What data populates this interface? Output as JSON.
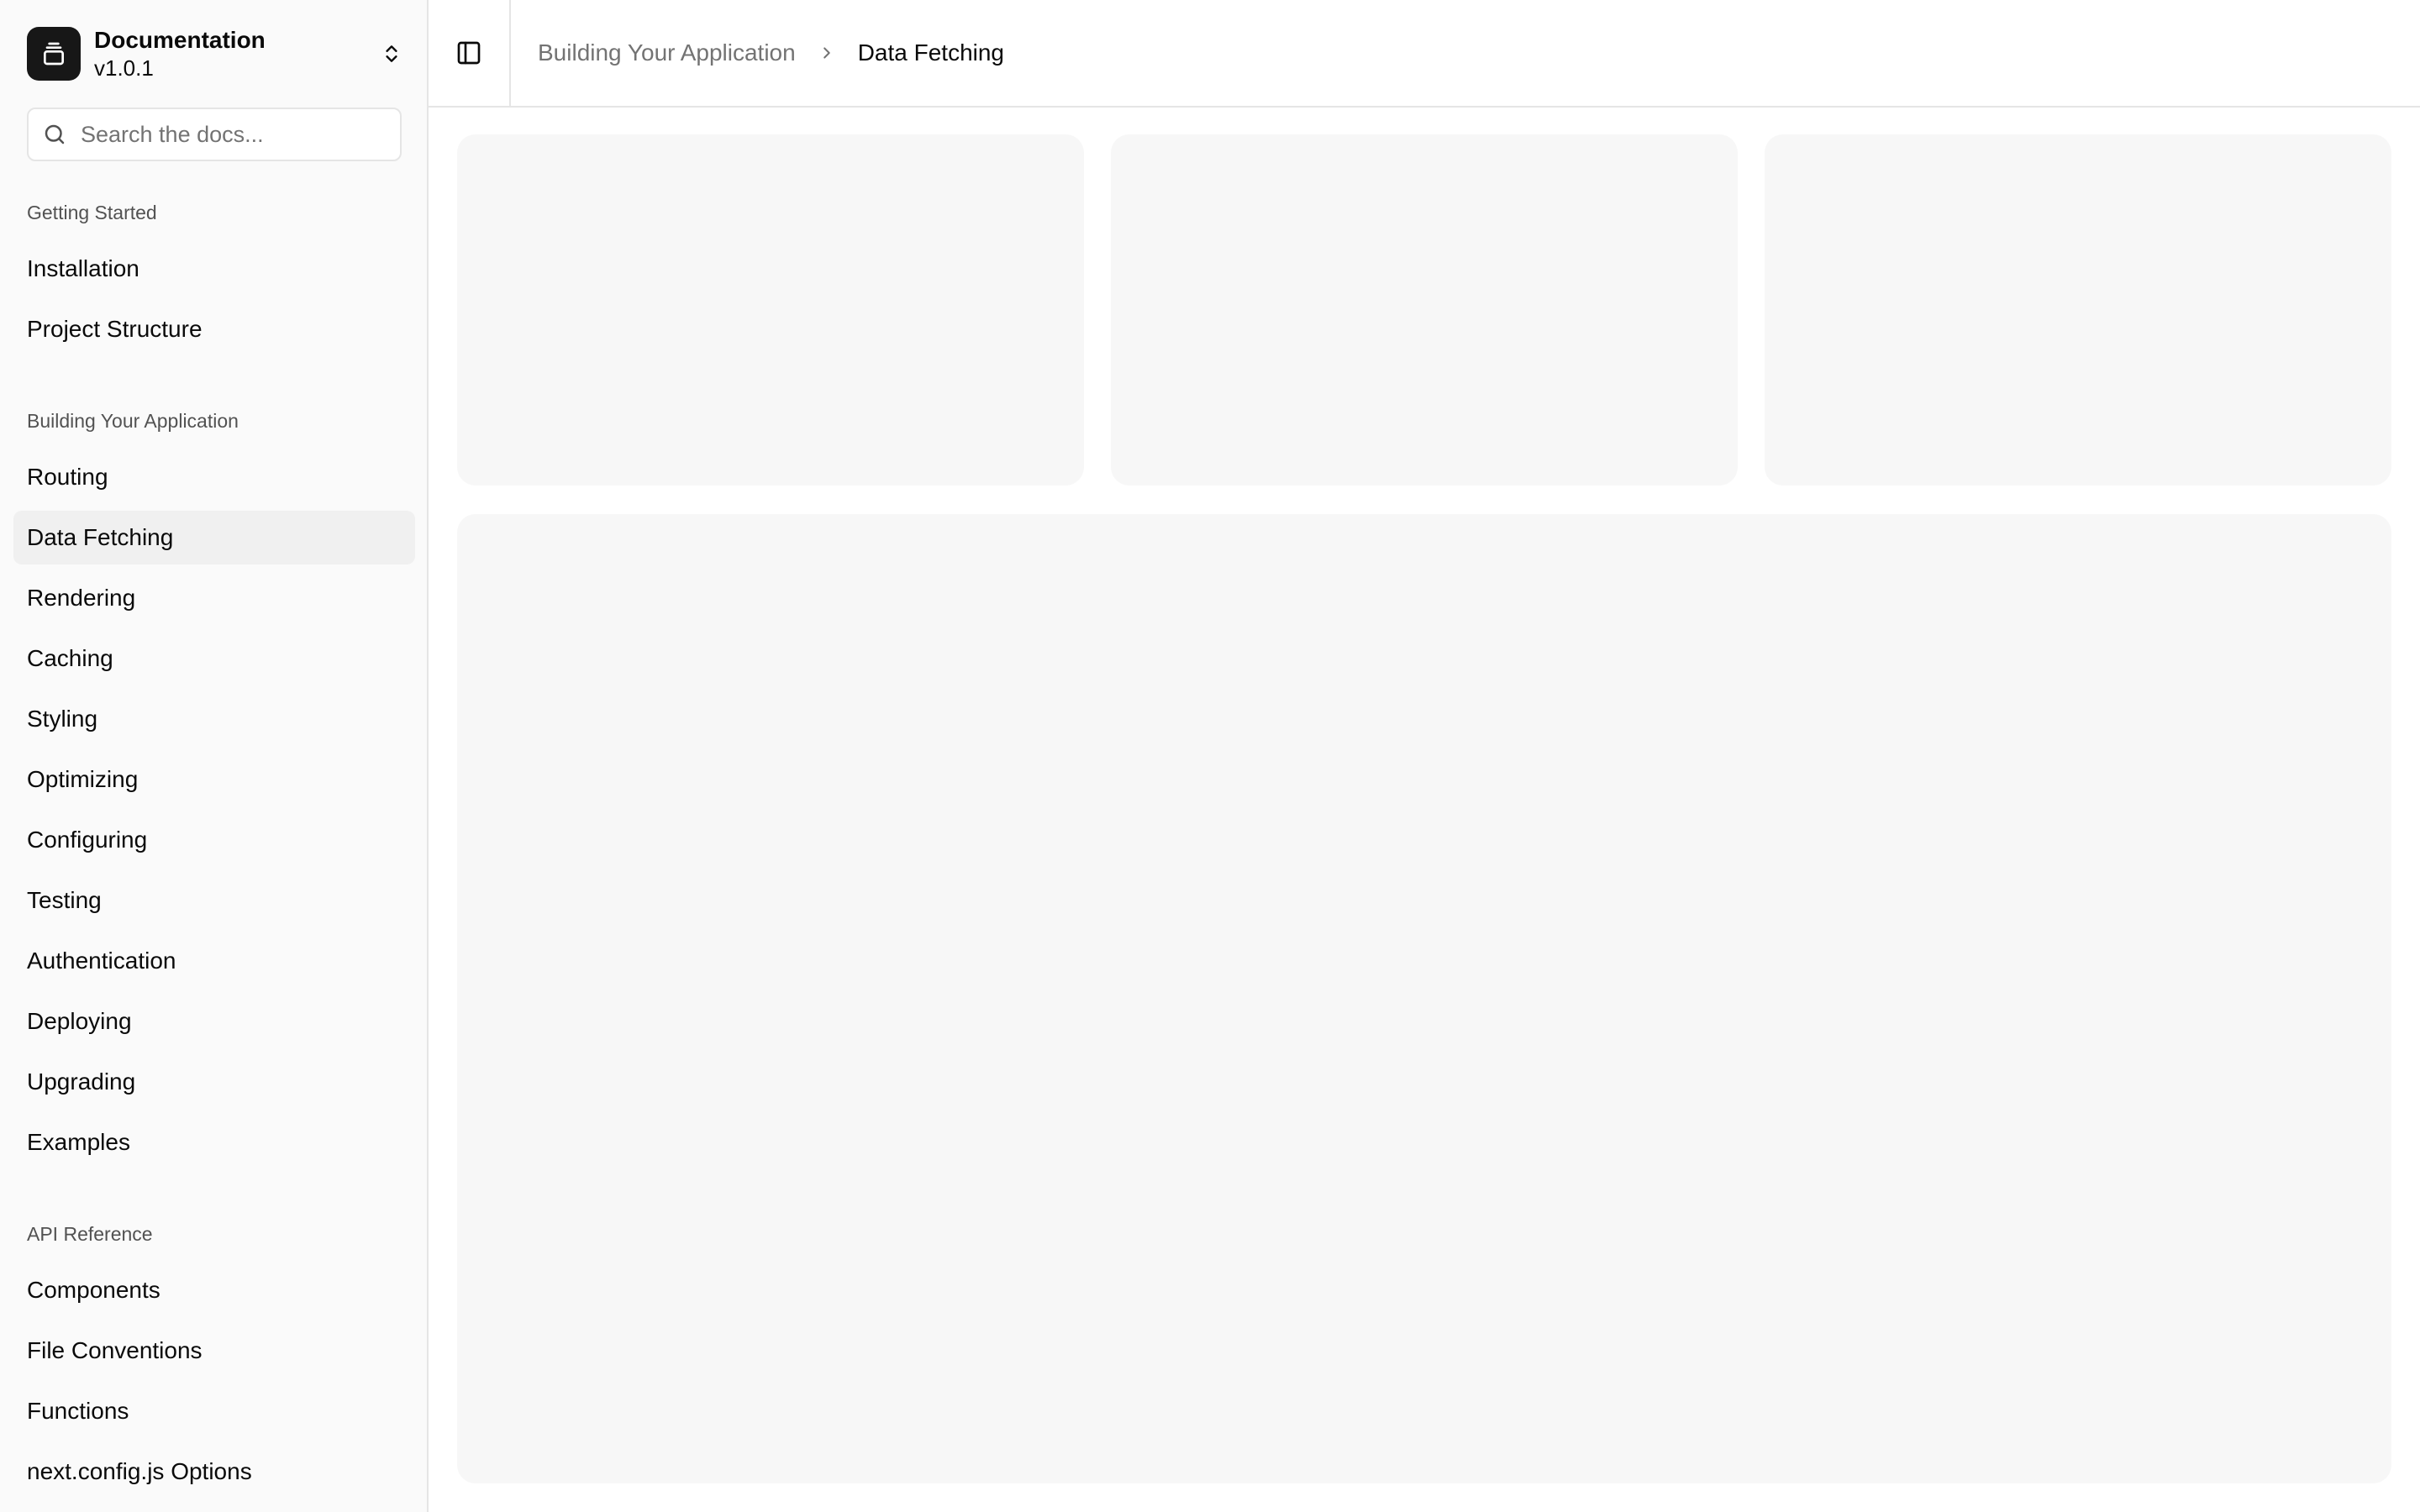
{
  "app": {
    "title": "Documentation",
    "version": "v1.0.1"
  },
  "search": {
    "placeholder": "Search the docs..."
  },
  "sidebar": {
    "groups": [
      {
        "label": "Getting Started",
        "items": [
          {
            "label": "Installation"
          },
          {
            "label": "Project Structure"
          }
        ]
      },
      {
        "label": "Building Your Application",
        "items": [
          {
            "label": "Routing"
          },
          {
            "label": "Data Fetching",
            "active": true
          },
          {
            "label": "Rendering"
          },
          {
            "label": "Caching"
          },
          {
            "label": "Styling"
          },
          {
            "label": "Optimizing"
          },
          {
            "label": "Configuring"
          },
          {
            "label": "Testing"
          },
          {
            "label": "Authentication"
          },
          {
            "label": "Deploying"
          },
          {
            "label": "Upgrading"
          },
          {
            "label": "Examples"
          }
        ]
      },
      {
        "label": "API Reference",
        "items": [
          {
            "label": "Components"
          },
          {
            "label": "File Conventions"
          },
          {
            "label": "Functions"
          },
          {
            "label": "next.config.js Options"
          }
        ]
      }
    ]
  },
  "breadcrumb": {
    "parent": "Building Your Application",
    "current": "Data Fetching"
  },
  "icons": {
    "logo": "gallery-stack-icon",
    "switcher": "chevrons-up-down-icon",
    "search": "search-icon",
    "sidebar_toggle": "panel-left-icon",
    "separator": "chevron-right-icon"
  },
  "colors": {
    "sidebar_bg": "#fafafa",
    "active_item_bg": "#f0f0f0",
    "placeholder_card": "#f7f7f7",
    "border": "#e5e5e5",
    "logo_bg": "#171717"
  }
}
